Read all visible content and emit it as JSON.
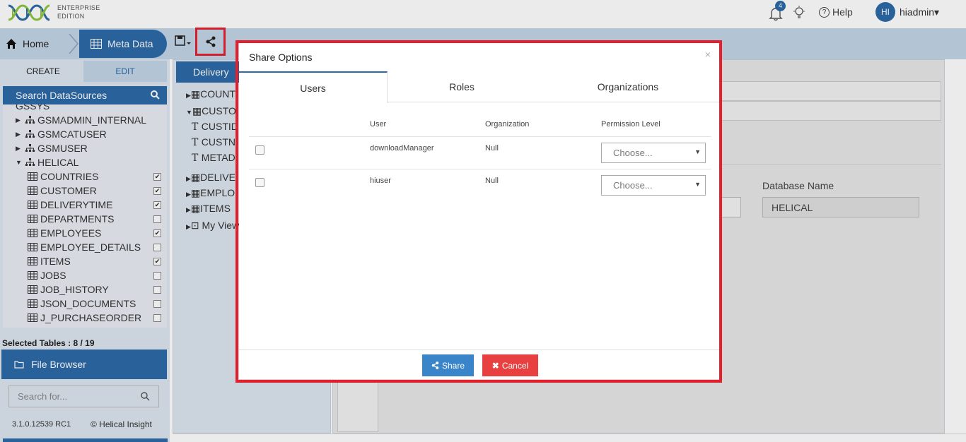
{
  "app": {
    "logo_line1": "ENTERPRISE",
    "logo_line2": "EDITION",
    "notification_count": "4",
    "help_label": "Help",
    "avatar_initials": "HI",
    "username": "hiadmin",
    "icons": [
      "bell-icon",
      "bulb-icon",
      "help-icon",
      "chevron-down-icon"
    ]
  },
  "nav": {
    "home_label": "Home",
    "metadata_label": "Meta Data",
    "icons": [
      "home-icon",
      "table-icon",
      "save-icon",
      "share-icon"
    ]
  },
  "left_panel": {
    "tab_create": "CREATE",
    "tab_edit": "EDIT",
    "search_label": "Search DataSources",
    "tree": [
      {
        "label": "GSMADMIN_INTERNAL",
        "type": "schema"
      },
      {
        "label": "GSMCATUSER",
        "type": "schema"
      },
      {
        "label": "GSMUSER",
        "type": "schema"
      },
      {
        "label": "HELICAL",
        "type": "schema",
        "expanded": true
      },
      {
        "label": "COUNTRIES",
        "type": "table",
        "checked": true
      },
      {
        "label": "CUSTOMER",
        "type": "table",
        "checked": true
      },
      {
        "label": "DELIVERYTIME",
        "type": "table",
        "checked": true
      },
      {
        "label": "DEPARTMENTS",
        "type": "table",
        "checked": false
      },
      {
        "label": "EMPLOYEES",
        "type": "table",
        "checked": true
      },
      {
        "label": "EMPLOYEE_DETAILS",
        "type": "table",
        "checked": false
      },
      {
        "label": "ITEMS",
        "type": "table",
        "checked": true
      },
      {
        "label": "JOBS",
        "type": "table",
        "checked": false
      },
      {
        "label": "JOB_HISTORY",
        "type": "table",
        "checked": false
      },
      {
        "label": "JSON_DOCUMENTS",
        "type": "table",
        "checked": false
      },
      {
        "label": "J_PURCHASEORDER",
        "type": "table",
        "checked": false
      }
    ],
    "selected_tables": "Selected Tables : 8 / 19",
    "file_browser": "File Browser",
    "search_placeholder": "Search for...",
    "version": "3.1.0.12539 RC1",
    "copyright": "© Helical Insight"
  },
  "middle_panel": {
    "tab_label": "Delivery",
    "rows": [
      {
        "label": "COUNT",
        "kind": "table",
        "arrow": "right"
      },
      {
        "label": "CUSTO",
        "kind": "table",
        "arrow": "down"
      },
      {
        "label": "CUSTID",
        "kind": "column"
      },
      {
        "label": "CUSTN",
        "kind": "column"
      },
      {
        "label": "METAD",
        "kind": "column"
      },
      {
        "label": "DELIVE",
        "kind": "table",
        "arrow": "right"
      },
      {
        "label": "EMPLO",
        "kind": "table",
        "arrow": "right"
      },
      {
        "label": "ITEMS",
        "kind": "table",
        "arrow": "right"
      },
      {
        "label": "My View",
        "kind": "view",
        "arrow": "right"
      }
    ]
  },
  "right_panel": {
    "database_label": "Database Name",
    "database_value": "HELICAL"
  },
  "modal": {
    "title": "Share Options",
    "close": "×",
    "tabs": [
      "Users",
      "Roles",
      "Organizations"
    ],
    "headers": {
      "user": "User",
      "organization": "Organization",
      "permission": "Permission Level"
    },
    "rows": [
      {
        "user": "downloadManager",
        "organization": "Null",
        "permission": "Choose..."
      },
      {
        "user": "hiuser",
        "organization": "Null",
        "permission": "Choose..."
      }
    ],
    "share_label": "Share",
    "cancel_label": "Cancel"
  },
  "colors": {
    "accent": "#2d6aa9",
    "highlight": "#e3212e",
    "share_button": "#3a85c9",
    "cancel_button": "#e84040"
  }
}
